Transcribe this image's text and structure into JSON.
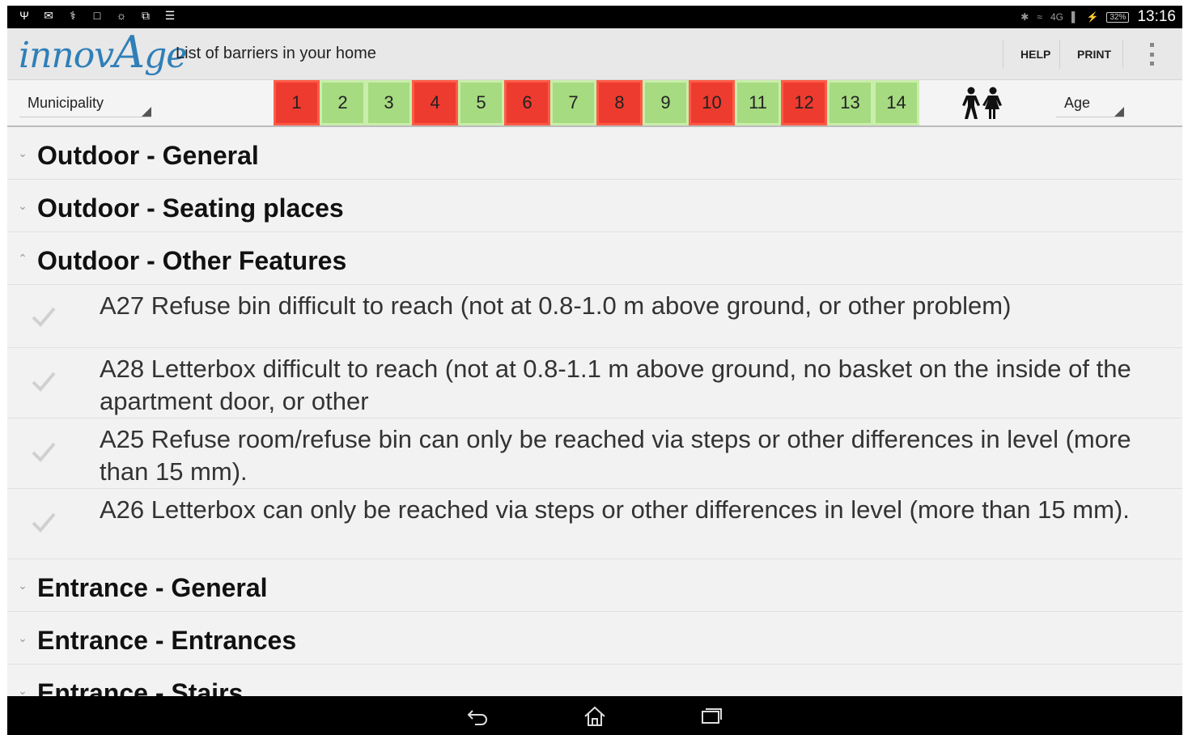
{
  "status_bar": {
    "left_icons": [
      "usb-icon",
      "gmail-icon",
      "usb-debug-icon",
      "screenshot-icon",
      "brightness-icon",
      "screen-mirror-icon",
      "android-icon"
    ],
    "network": "4G",
    "battery": "32%",
    "time": "13:16"
  },
  "action_bar": {
    "logo_part1": "innov",
    "logo_part2": "A",
    "logo_part3": "ge",
    "title": "List of barriers in your home",
    "help_label": "HELP",
    "print_label": "PRINT",
    "overflow_icon": "overflow-menu-icon"
  },
  "filters": {
    "municipality_label": "Municipality",
    "age_label": "Age",
    "numbers": [
      {
        "label": "1",
        "status": "red"
      },
      {
        "label": "2",
        "status": "green"
      },
      {
        "label": "3",
        "status": "green"
      },
      {
        "label": "4",
        "status": "red"
      },
      {
        "label": "5",
        "status": "green"
      },
      {
        "label": "6",
        "status": "red"
      },
      {
        "label": "7",
        "status": "green"
      },
      {
        "label": "8",
        "status": "red"
      },
      {
        "label": "9",
        "status": "green"
      },
      {
        "label": "10",
        "status": "red"
      },
      {
        "label": "11",
        "status": "green"
      },
      {
        "label": "12",
        "status": "red"
      },
      {
        "label": "13",
        "status": "green"
      },
      {
        "label": "14",
        "status": "green"
      }
    ],
    "people_icon": "man-woman-icon",
    "colors": {
      "red": "#ee3b2f",
      "green": "#a6db81"
    }
  },
  "list": {
    "sections_top": [
      {
        "title": "Outdoor - General",
        "expanded": false
      },
      {
        "title": "Outdoor - Seating places",
        "expanded": false
      },
      {
        "title": "Outdoor - Other Features",
        "expanded": true
      }
    ],
    "items": [
      {
        "text": "A27 Refuse bin difficult to reach (not at 0.8-1.0 m above ground, or other problem)",
        "checked": false
      },
      {
        "text": "A28 Letterbox difficult to reach (not at 0.8-1.1 m above ground, no basket on the inside of the apartment door, or other",
        "checked": false
      },
      {
        "text": "A25 Refuse room/refuse bin can only be reached via steps or other differences in level (more than 15 mm).",
        "checked": false
      },
      {
        "text": "A26 Letterbox can only be reached via steps or other differences in level (more than 15 mm).",
        "checked": false
      }
    ],
    "sections_bottom": [
      {
        "title": "Entrance - General",
        "expanded": false
      },
      {
        "title": "Entrance - Entrances",
        "expanded": false
      },
      {
        "title": "Entrance - Stairs",
        "expanded": false
      }
    ]
  },
  "nav_bar": {
    "icons": [
      "back-icon",
      "home-icon",
      "recent-apps-icon"
    ]
  }
}
